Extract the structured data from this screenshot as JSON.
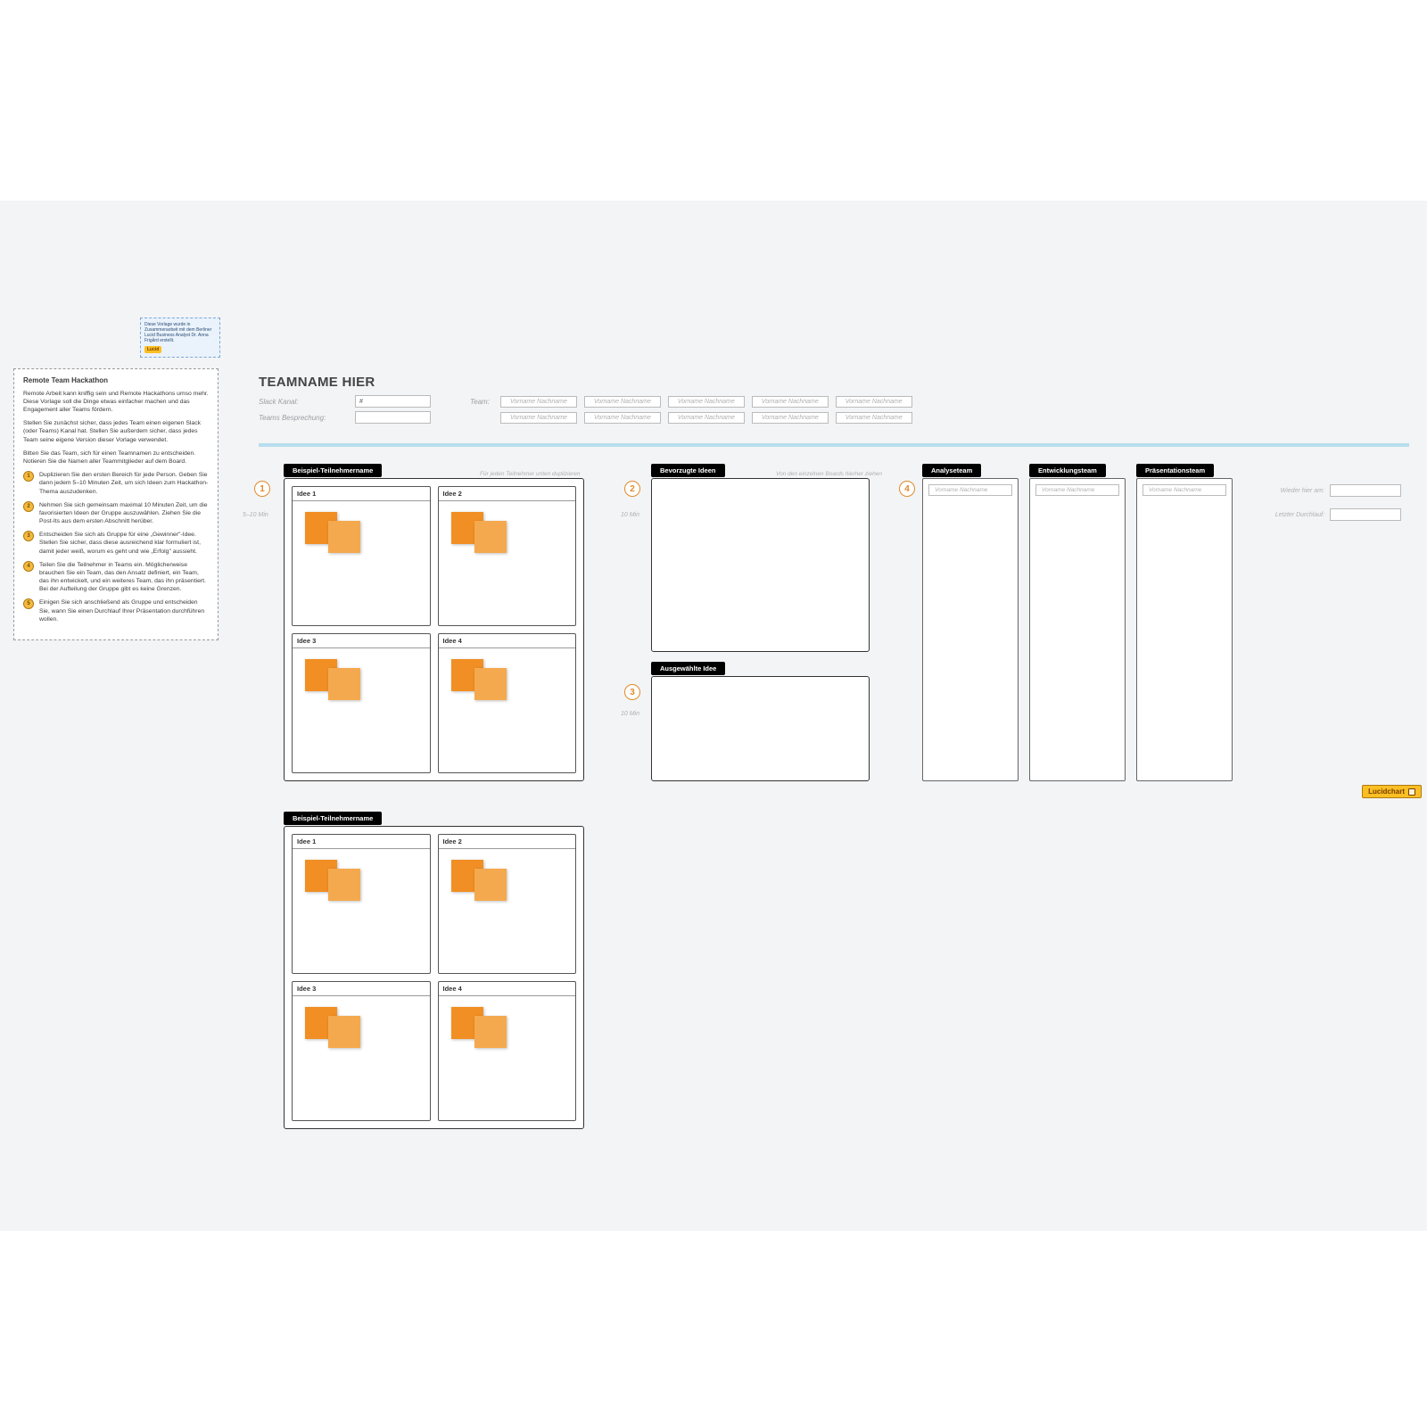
{
  "floating_note": {
    "text": "Diese Vorlage wurde in Zusammenarbeit mit dem Berliner Lucid Business Analyst Dr. Anna Frigård erstellt.",
    "badge": "Lucid"
  },
  "instructions": {
    "title": "Remote Team Hackathon",
    "p1": "Remote Arbeit kann kniffig sein und Remote Hackathons umso mehr. Diese Vorlage soll die Dinge etwas einfacher machen und das Engagement aller Teams fördern.",
    "p2": "Stellen Sie zunächst sicher, dass jedes Team einen eigenen Slack (oder Teams) Kanal hat. Stellen Sie außerdem sicher, dass jedes Team seine eigene Version dieser Vorlage verwendet.",
    "p3": "Bitten Sie das Team, sich für einen Teamnamen zu entscheiden. Notieren Sie die Namen aller Teammitglieder auf dem Board.",
    "steps": [
      "Duplizieren Sie den ersten Bereich für jede Person. Geben Sie dann jedem 5–10 Minuten Zeit, um sich Ideen zum Hackathon-Thema auszudenken.",
      "Nehmen Sie sich gemeinsam maximal 10 Minuten Zeit, um die favorisierten Ideen der Gruppe auszuwählen. Ziehen Sie die Post-Its aus dem ersten Abschnitt herüber.",
      "Entscheiden Sie sich als Gruppe für eine „Gewinner\"-Idee. Stellen Sie sicher, dass diese ausreichend klar formuliert ist, damit jeder weiß, worum es geht und wie „Erfolg\" aussieht.",
      "Teilen Sie die Teilnehmer in Teams ein. Möglicherweise brauchen Sie ein Team, das den Ansatz definiert, ein Team, das ihn entwickelt, und ein weiteres Team, das ihn präsentiert. Bei der Aufteilung der Gruppe gibt es keine Grenzen.",
      "Einigen Sie sich anschließend als Gruppe und entscheiden Sie, wann Sie einen Durchlauf Ihrer Präsentation durchführen wollen."
    ]
  },
  "header": {
    "team_title": "TEAMNAME HIER",
    "slack_label": "Slack Kanal:",
    "slack_value": "#",
    "meeting_label": "Teams Besprechung:",
    "team_label": "Team:",
    "member_placeholder": "Vorname Nachname"
  },
  "steps": {
    "s1": {
      "num": "1",
      "time": "5–10 Min",
      "note": "Für jeden Teilnehmer unten duplizieren"
    },
    "s2": {
      "num": "2",
      "time": "10 Min"
    },
    "s3": {
      "num": "3",
      "time": "10 Min",
      "note": "Von den einzelnen Boards hierher ziehen"
    },
    "s4": {
      "num": "4"
    }
  },
  "labels": {
    "participant": "Beispiel-Teilnehmername",
    "fav_ideas": "Bevorzugte Ideen",
    "selected_idea": "Ausgewählte Idee",
    "analysis_team": "Analyseteam",
    "dev_team": "Entwicklungsteam",
    "pres_team": "Präsentationsteam"
  },
  "ideas": [
    "Idee 1",
    "Idee 2",
    "Idee 3",
    "Idee 4"
  ],
  "meta": {
    "meet_again": "Wieder hier am:",
    "last_run": "Letzter Durchlauf:"
  },
  "badge": "Lucidchart"
}
